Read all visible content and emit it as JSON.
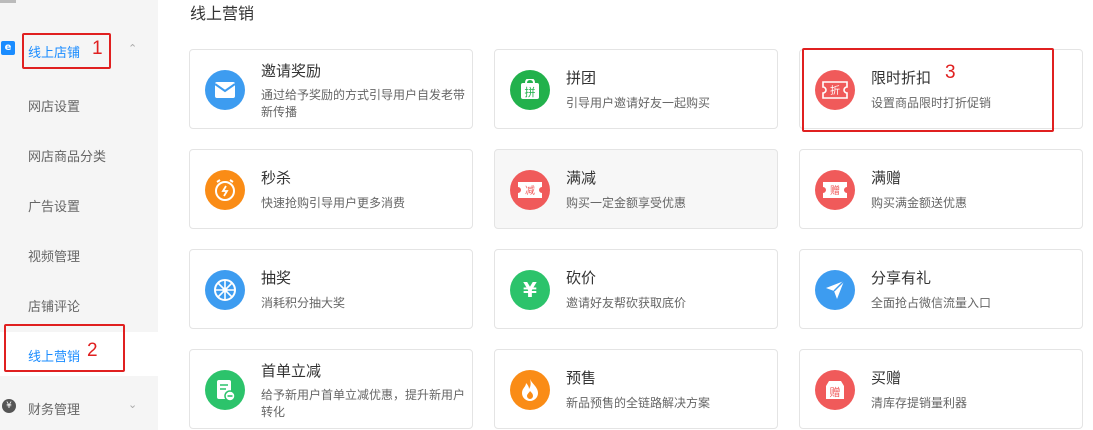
{
  "sidebar": {
    "group_label": "线上店铺",
    "group_icon": "e",
    "items": [
      {
        "label": "网店设置"
      },
      {
        "label": "网店商品分类"
      },
      {
        "label": "广告设置"
      },
      {
        "label": "视频管理"
      },
      {
        "label": "店铺评论"
      },
      {
        "label": "线上营销"
      }
    ],
    "bottom_label": "财务管理",
    "bottom_icon": "¥"
  },
  "annotations": [
    "1",
    "2",
    "3"
  ],
  "main": {
    "title": "线上营销",
    "cards": [
      {
        "title": "邀请奖励",
        "desc": "通过给予奖励的方式引导用户自发老带新传播",
        "icon": "envelope-icon",
        "color": "#3d9cf0"
      },
      {
        "title": "拼团",
        "desc": "引导用户邀请好友一起购买",
        "icon": "group-buy-icon",
        "color": "#22b14c",
        "glyph": "拼"
      },
      {
        "title": "限时折扣",
        "desc": "设置商品限时打折促销",
        "icon": "discount-ticket-icon",
        "color": "#f05a5a",
        "glyph": "折"
      },
      {
        "title": "秒杀",
        "desc": "快速抢购引导用户更多消费",
        "icon": "alarm-icon",
        "color": "#fa8c16"
      },
      {
        "title": "满减",
        "desc": "购买一定金额享受优惠",
        "icon": "reduce-ticket-icon",
        "color": "#f05a5a",
        "glyph": "减"
      },
      {
        "title": "满赠",
        "desc": "购买满金额送优惠",
        "icon": "gift-ticket-icon",
        "color": "#f05a5a",
        "glyph": "赠"
      },
      {
        "title": "抽奖",
        "desc": "消耗积分抽大奖",
        "icon": "wheel-icon",
        "color": "#3d9cf0"
      },
      {
        "title": "砍价",
        "desc": "邀请好友帮砍获取底价",
        "icon": "yuan-icon",
        "color": "#2cc36b",
        "glyph": "¥"
      },
      {
        "title": "分享有礼",
        "desc": "全面抢占微信流量入口",
        "icon": "send-icon",
        "color": "#3d9cf0"
      },
      {
        "title": "首单立减",
        "desc": "给予新用户首单立减优惠，提升新用户转化",
        "icon": "order-icon",
        "color": "#2cc36b"
      },
      {
        "title": "预售",
        "desc": "新品预售的全链路解决方案",
        "icon": "flame-icon",
        "color": "#fa8c16"
      },
      {
        "title": "买赠",
        "desc": "清库存提销量利器",
        "icon": "buy-gift-icon",
        "color": "#f05a5a",
        "glyph": "赠"
      }
    ]
  }
}
